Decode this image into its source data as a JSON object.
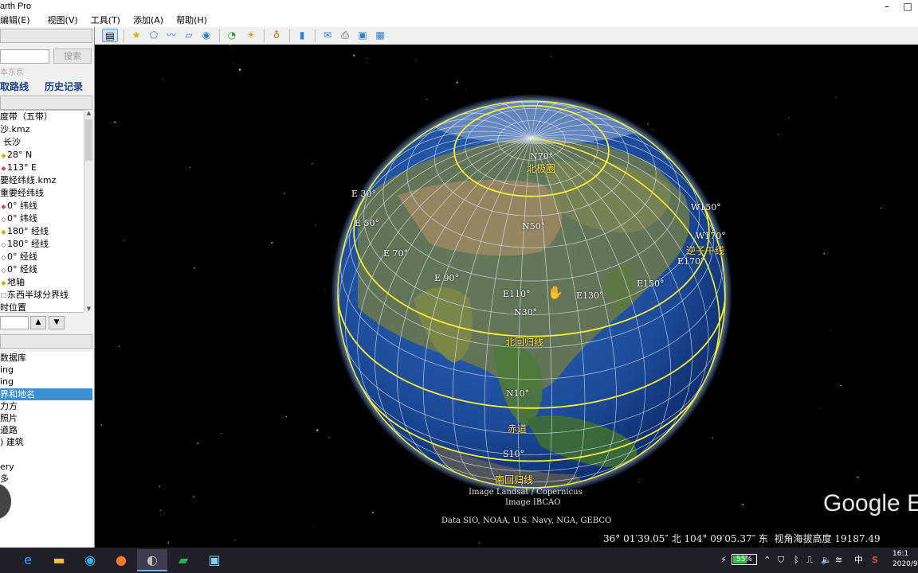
{
  "app": {
    "title": "arth Pro"
  },
  "window_controls": {
    "minimize": "–",
    "restore": "□"
  },
  "menu": [
    "编辑(E)",
    "视图(V)",
    "工具(T)",
    "添加(A)",
    "帮助(H)"
  ],
  "search": {
    "button": "搜索",
    "hint": "本东京"
  },
  "links": {
    "directions": "取路线",
    "history": "历史记录"
  },
  "places": [
    "度带（五带）",
    "沙.kmz",
    "长沙",
    "28° N",
    "113° E",
    "要经纬线.kmz",
    "重要经纬线",
    "0° 纬线",
    "0° 纬线",
    "180° 经线",
    "180° 经线",
    "0° 经线",
    "0° 经线",
    "地轴",
    "东西半球分界线",
    "时位置"
  ],
  "layers": [
    "数据库",
    "ing",
    "ing",
    "界和地名",
    "力方",
    "照片",
    "道路",
    ") 建筑",
    "",
    "ery",
    "多"
  ],
  "layers_selected_index": 3,
  "globe_labels": {
    "n70": "N70°",
    "arctic": "北极圈",
    "e30": "E 30°",
    "e50": "E 50°",
    "e70": "E 70°",
    "e90": "E 90°",
    "n50": "N50°",
    "w150": "W150°",
    "w170": "W170°",
    "dateline": "逆子午线",
    "e170": "E170°",
    "e150": "E150°",
    "e110": "E110°",
    "e130": "E130°",
    "n30": "N30°",
    "tropic_cancer": "北回归线",
    "n10": "N10°",
    "equator": "赤道",
    "s10": "S10°",
    "tropic_capricorn": "南回归线"
  },
  "credits": {
    "imagery": "Image Landsat / Copernicus",
    "ibcao": "Image IBCAO",
    "data": "Data SIO, NOAA, U.S. Navy, NGA, GEBCO"
  },
  "watermark": "Google E",
  "status": {
    "coordinates": "36° 01′39.05″ 北 104° 09′05.37″ 东  视角海拔高度 19187.49"
  },
  "taskbar": {
    "battery_label": "55%",
    "battery_level": 0.55,
    "ime": "中",
    "time": "16:1",
    "date": "2020/9"
  },
  "colors": {
    "graticule": "#e8f0ff",
    "special_lines": "#f5f033",
    "ocean": "#1d4b99",
    "selection": "#3c8fd0"
  }
}
